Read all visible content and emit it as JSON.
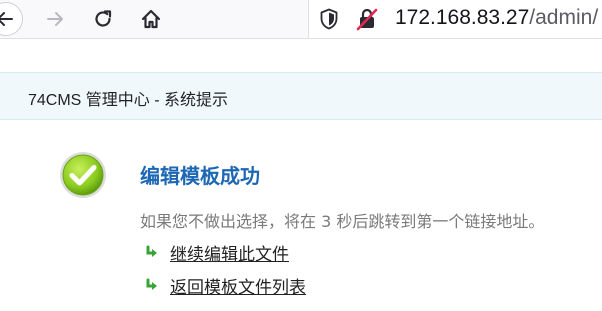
{
  "browser": {
    "url_host": "172.168.83.27",
    "url_path": "/admin/"
  },
  "header": {
    "title": "74CMS 管理中心 - 系统提示"
  },
  "message": {
    "title": "编辑模板成功",
    "redirect_text": "如果您不做出选择，将在 3 秒后跳转到第一个链接地址。",
    "links": [
      {
        "label": "继续编辑此文件"
      },
      {
        "label": "返回模板文件列表"
      }
    ]
  },
  "icons": {
    "back": "back-arrow-icon",
    "forward": "forward-arrow-icon",
    "reload": "reload-icon",
    "home": "home-icon",
    "tracking": "tracking-shield-icon",
    "insecure": "insecure-lock-icon",
    "success": "success-check-icon",
    "link": "green-arrow-icon"
  },
  "colors": {
    "title_blue": "#1d67b4",
    "success_green": "#7cc11f",
    "link_arrow_green": "#3aa335"
  }
}
